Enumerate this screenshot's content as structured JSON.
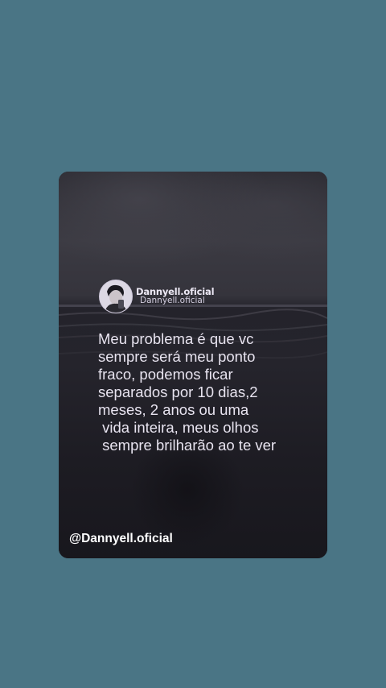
{
  "colors": {
    "page_background": "#4a7585",
    "card_background": "#1c1b22",
    "text": "#e8e4f0"
  },
  "post": {
    "author_name": "Dannyell.oficial",
    "author_handle": "Dannyell.oficial",
    "avatar_icon": "profile-photo-avatar",
    "quote_lines": [
      "Meu problema é que vc",
      "sempre será meu ponto",
      "fraco, podemos ficar",
      "separados por 10 dias,2",
      "meses, 2 anos ou uma",
      " vida inteira, meus olhos",
      " sempre brilharão ao te ver"
    ]
  },
  "watermark": "@Dannyell.oficial"
}
